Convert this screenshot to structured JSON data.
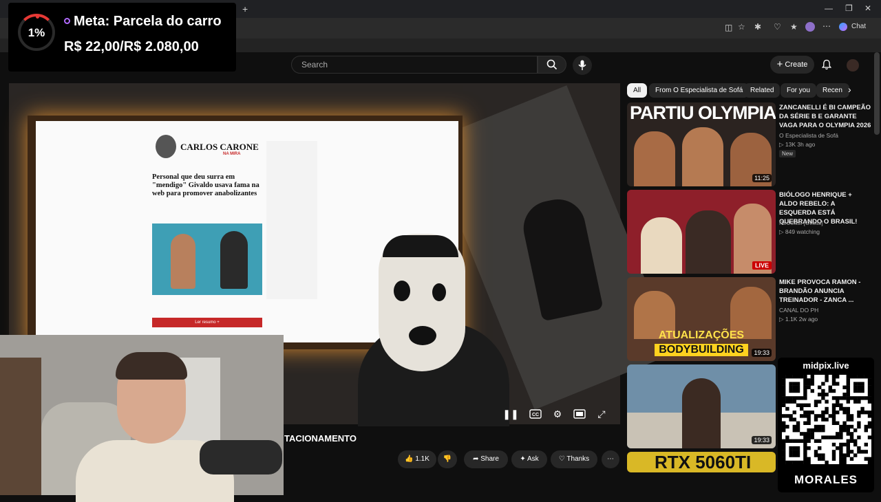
{
  "browser": {
    "new_tab": "+",
    "chat_label": "Chat"
  },
  "goal_widget": {
    "percent": "1%",
    "progress_fraction": 0.01,
    "title": "Meta: Parcela do carro",
    "amount": "R$ 22,00/R$ 2.080,00"
  },
  "header": {
    "search_placeholder": "Search",
    "create_label": "Create"
  },
  "video": {
    "title": "TACIONAMENTO",
    "screen_article": {
      "column_title": "CARLOS CARONE",
      "column_sub": "NA MIRA",
      "headline": "Personal que deu surra em \"mendigo\" Givaldo usava fama na web para promover anabolizantes",
      "read_button": "Ler resumo +"
    }
  },
  "actions": {
    "like_count": "1.1K",
    "share": "Share",
    "ask": "Ask",
    "thanks": "Thanks"
  },
  "chips": [
    "All",
    "From O Especialista de Sofá",
    "Related",
    "For you",
    "Recen"
  ],
  "related": [
    {
      "title": "ZANCANELLI É BI CAMPEÃO DA SÉRIE B E GARANTE VAGA PARA O OLYMPIA 2026",
      "channel": "O Especialista de Sofá",
      "meta": "▷ 13K  3h ago",
      "badge": "New",
      "duration": "11:25",
      "thumb_text": "PARTIU OLYMPIA",
      "thumb_color": "#2b2320"
    },
    {
      "title": "BIÓLOGO HENRIQUE + ALDO REBELO: A ESQUERDA ESTÁ QUEBRANDO O BRASIL!",
      "channel": "RedCast [Oficial]",
      "meta": "▷ 849 watching",
      "live": "LIVE",
      "thumb_color": "#8e1f2a"
    },
    {
      "title": "MIKE PROVOCA RAMON - BRANDÃO ANUNCIA TREINADOR - ZANCA ...",
      "channel": "CANAL DO PH",
      "meta": "▷ 1.1K  2w ago",
      "duration": "19:33",
      "thumb_text_1": "ATUALIZAÇÕES",
      "thumb_text_2": "BODYBUILDING",
      "thumb_color": "#5a3a2a"
    },
    {
      "duration": "19:33",
      "thumb_color": "#6f8fa8"
    },
    {
      "thumb_text": "RTX 5060TI",
      "thumb_color": "#d9b826"
    }
  ],
  "qr_overlay": {
    "top": "midpix.live",
    "bottom": "MORALES"
  }
}
